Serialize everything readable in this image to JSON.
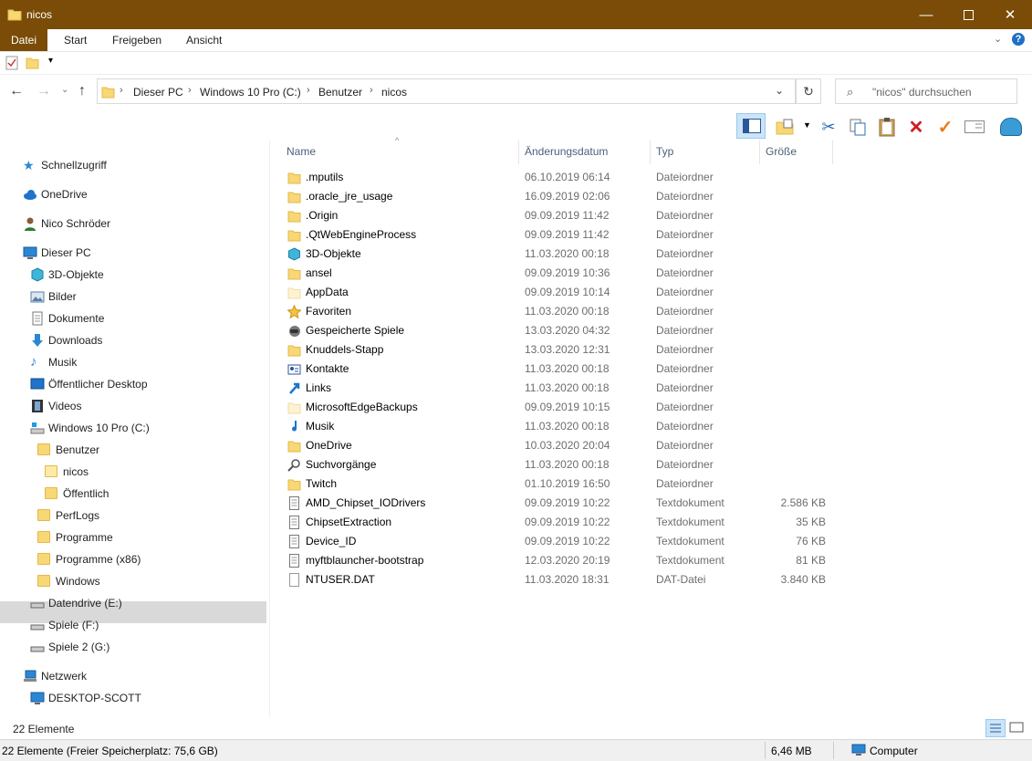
{
  "window": {
    "title": "nicos"
  },
  "ribbon": {
    "tabs": [
      "Datei",
      "Start",
      "Freigeben",
      "Ansicht"
    ]
  },
  "address": {
    "crumbs": [
      "Dieser PC",
      "Windows 10 Pro (C:)",
      "Benutzer",
      "nicos"
    ],
    "search_placeholder": "\"nicos\" durchsuchen"
  },
  "columns": {
    "name": "Name",
    "date": "Änderungsdatum",
    "type": "Typ",
    "size": "Größe"
  },
  "nav": {
    "quick": "Schnellzugriff",
    "onedrive": "OneDrive",
    "user": "Nico Schröder",
    "thispc": "Dieser PC",
    "objects3d": "3D-Objekte",
    "pictures": "Bilder",
    "documents": "Dokumente",
    "downloads": "Downloads",
    "music": "Musik",
    "publicdesktop": "Öffentlicher Desktop",
    "videos": "Videos",
    "cdrive": "Windows 10 Pro (C:)",
    "users": "Benutzer",
    "nicos": "nicos",
    "public": "Öffentlich",
    "perflogs": "PerfLogs",
    "programs": "Programme",
    "programs86": "Programme (x86)",
    "windows": "Windows",
    "edrive": "Datendrive (E:)",
    "fdrive": "Spiele (F:)",
    "gdrive": "Spiele 2 (G:)",
    "network": "Netzwerk",
    "desktopscott": "DESKTOP-SCOTT"
  },
  "files": [
    {
      "name": ".mputils",
      "date": "06.10.2019 06:14",
      "type": "Dateiordner",
      "size": "",
      "icon": "folder"
    },
    {
      "name": ".oracle_jre_usage",
      "date": "16.09.2019 02:06",
      "type": "Dateiordner",
      "size": "",
      "icon": "folder"
    },
    {
      "name": ".Origin",
      "date": "09.09.2019 11:42",
      "type": "Dateiordner",
      "size": "",
      "icon": "folder"
    },
    {
      "name": ".QtWebEngineProcess",
      "date": "09.09.2019 11:42",
      "type": "Dateiordner",
      "size": "",
      "icon": "folder"
    },
    {
      "name": "3D-Objekte",
      "date": "11.03.2020 00:18",
      "type": "Dateiordner",
      "size": "",
      "icon": "cube"
    },
    {
      "name": "ansel",
      "date": "09.09.2019 10:36",
      "type": "Dateiordner",
      "size": "",
      "icon": "folder"
    },
    {
      "name": "AppData",
      "date": "09.09.2019 10:14",
      "type": "Dateiordner",
      "size": "",
      "icon": "folder-faded"
    },
    {
      "name": "Favoriten",
      "date": "11.03.2020 00:18",
      "type": "Dateiordner",
      "size": "",
      "icon": "star"
    },
    {
      "name": "Gespeicherte Spiele",
      "date": "13.03.2020 04:32",
      "type": "Dateiordner",
      "size": "",
      "icon": "gamepad"
    },
    {
      "name": "Knuddels-Stapp",
      "date": "13.03.2020 12:31",
      "type": "Dateiordner",
      "size": "",
      "icon": "folder"
    },
    {
      "name": "Kontakte",
      "date": "11.03.2020 00:18",
      "type": "Dateiordner",
      "size": "",
      "icon": "contact"
    },
    {
      "name": "Links",
      "date": "11.03.2020 00:18",
      "type": "Dateiordner",
      "size": "",
      "icon": "link"
    },
    {
      "name": "MicrosoftEdgeBackups",
      "date": "09.09.2019 10:15",
      "type": "Dateiordner",
      "size": "",
      "icon": "folder-faded"
    },
    {
      "name": "Musik",
      "date": "11.03.2020 00:18",
      "type": "Dateiordner",
      "size": "",
      "icon": "music"
    },
    {
      "name": "OneDrive",
      "date": "10.03.2020 20:04",
      "type": "Dateiordner",
      "size": "",
      "icon": "folder"
    },
    {
      "name": "Suchvorgänge",
      "date": "11.03.2020 00:18",
      "type": "Dateiordner",
      "size": "",
      "icon": "search"
    },
    {
      "name": "Twitch",
      "date": "01.10.2019 16:50",
      "type": "Dateiordner",
      "size": "",
      "icon": "folder"
    },
    {
      "name": "AMD_Chipset_IODrivers",
      "date": "09.09.2019 10:22",
      "type": "Textdokument",
      "size": "2.586 KB",
      "icon": "textdoc"
    },
    {
      "name": "ChipsetExtraction",
      "date": "09.09.2019 10:22",
      "type": "Textdokument",
      "size": "35 KB",
      "icon": "textdoc"
    },
    {
      "name": "Device_ID",
      "date": "09.09.2019 10:22",
      "type": "Textdokument",
      "size": "76 KB",
      "icon": "textdoc"
    },
    {
      "name": "myftblauncher-bootstrap",
      "date": "12.03.2020 20:19",
      "type": "Textdokument",
      "size": "81 KB",
      "icon": "textdoc"
    },
    {
      "name": "NTUSER.DAT",
      "date": "11.03.2020 18:31",
      "type": "DAT-Datei",
      "size": "3.840 KB",
      "icon": "blankdoc"
    }
  ],
  "status": {
    "count": "22 Elemente",
    "free": "22 Elemente (Freier Speicherplatz: 75,6 GB)",
    "size": "6,46 MB",
    "location": "Computer"
  }
}
